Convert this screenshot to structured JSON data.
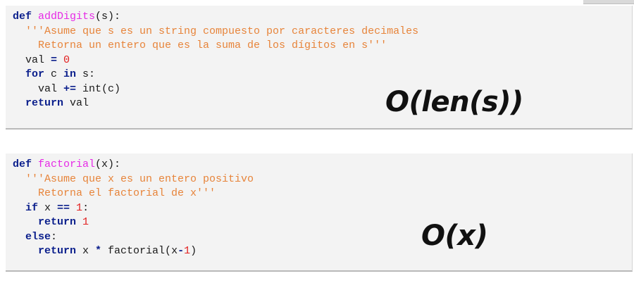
{
  "block1": {
    "def_kw": "def",
    "func_name": "addDigits",
    "sig_rest": "(s):",
    "doc_line1": "'''Asume que s es un string compuesto por caracteres decimales",
    "doc_line2": "Retorna un entero que es la suma de los dígitos en s'''",
    "assign_var": "val ",
    "assign_op": "=",
    "assign_val": "0",
    "for_kw": "for",
    "for_var": " c ",
    "in_kw": "in",
    "for_iter": " s:",
    "acc_var": "val ",
    "acc_op": "+=",
    "acc_expr": " int(c)",
    "return_kw": "return",
    "return_val": " val",
    "complexity": "O(len(s))"
  },
  "block2": {
    "def_kw": "def",
    "func_name": "factorial",
    "sig_rest": "(x):",
    "doc_line1": "'''Asume que x es un entero positivo",
    "doc_line2": "Retorna el factorial de x'''",
    "if_kw": "if",
    "if_var": " x ",
    "if_op": "==",
    "if_val": " 1",
    "if_colon": ":",
    "return1_kw": "return",
    "return1_val": "1",
    "else_kw": "else",
    "else_colon": ":",
    "return2_kw": "return",
    "return2_x": " x ",
    "return2_op": "*",
    "return2_call": " factorial(x",
    "return2_minus": "-",
    "return2_one": "1",
    "return2_close": ")",
    "complexity": "O(x)"
  }
}
